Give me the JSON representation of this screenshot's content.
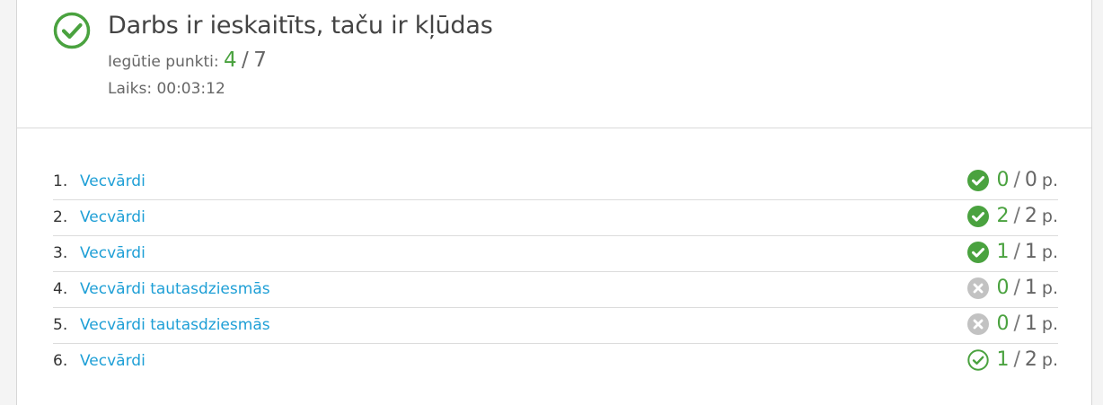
{
  "result": {
    "title": "Darbs ir ieskaitīts, taču ir kļūdas",
    "points_label": "Iegūtie punkti:",
    "points_got": "4",
    "points_sep": "/",
    "points_total": "7",
    "time_text": "Laiks: 00:03:12",
    "status_icon": "check-circle-outline-icon",
    "accent_color": "#4aa23f",
    "link_color": "#1e9fd6"
  },
  "tasks": [
    {
      "num": "1.",
      "label": "Vecvārdi",
      "got": "0",
      "sep": "/",
      "total": "0",
      "unit": "p.",
      "icon": "check-filled-icon"
    },
    {
      "num": "2.",
      "label": "Vecvārdi",
      "got": "2",
      "sep": "/",
      "total": "2",
      "unit": "p.",
      "icon": "check-filled-icon"
    },
    {
      "num": "3.",
      "label": "Vecvārdi",
      "got": "1",
      "sep": "/",
      "total": "1",
      "unit": "p.",
      "icon": "check-filled-icon"
    },
    {
      "num": "4.",
      "label": "Vecvārdi tautasdziesmās",
      "got": "0",
      "sep": "/",
      "total": "1",
      "unit": "p.",
      "icon": "x-gray-icon"
    },
    {
      "num": "5.",
      "label": "Vecvārdi tautasdziesmās",
      "got": "0",
      "sep": "/",
      "total": "1",
      "unit": "p.",
      "icon": "x-gray-icon"
    },
    {
      "num": "6.",
      "label": "Vecvārdi",
      "got": "1",
      "sep": "/",
      "total": "2",
      "unit": "p.",
      "icon": "check-outline-icon"
    }
  ]
}
